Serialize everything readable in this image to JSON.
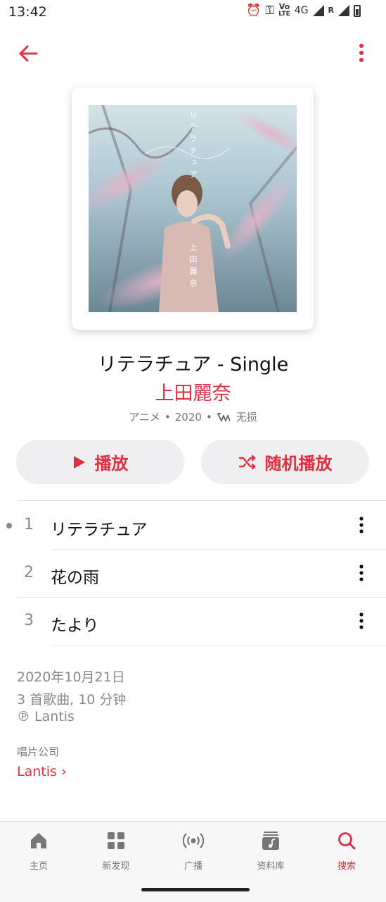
{
  "status_bar": {
    "time": "13:42",
    "volte": "Vo",
    "lte": "LTE",
    "network": "4G",
    "roaming": "R"
  },
  "toolbar": {
    "back_icon": "arrow-left-icon",
    "more_icon": "vertical-dots-icon",
    "accent_color": "#e0303f"
  },
  "album": {
    "title": "リテラチュア - Single",
    "artist": "上田麗奈",
    "genre": "アニメ",
    "year": "2020",
    "separator": "•",
    "lossless_label": "无损",
    "cover_text": {
      "title_vertical": "リテラチュア",
      "artist_vertical": "上田麗奈"
    }
  },
  "actions": {
    "play_label": "播放",
    "shuffle_label": "随机播放"
  },
  "tracks": [
    {
      "number": "1",
      "title": "リテラチュア",
      "now_playing": true
    },
    {
      "number": "2",
      "title": "花の雨",
      "now_playing": false
    },
    {
      "number": "3",
      "title": "たより",
      "now_playing": false
    }
  ],
  "info": {
    "release_date": "2020年10月21日",
    "summary": "3 首歌曲, 10 分钟",
    "copyright": "℗ Lantis",
    "label_heading": "唱片公司",
    "label_name": "Lantis",
    "label_chevron": "›"
  },
  "tabs": [
    {
      "label": "主页",
      "icon": "home-icon",
      "active": false
    },
    {
      "label": "新发现",
      "icon": "grid-icon",
      "active": false
    },
    {
      "label": "广播",
      "icon": "radio-icon",
      "active": false
    },
    {
      "label": "资料库",
      "icon": "music-library-icon",
      "active": false
    },
    {
      "label": "搜索",
      "icon": "search-icon",
      "active": true
    }
  ]
}
